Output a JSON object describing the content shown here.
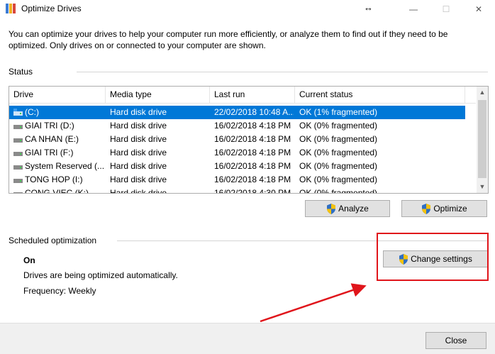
{
  "window": {
    "title": "Optimize Drives",
    "minimize_icon": "—",
    "maximize_icon": "☐",
    "close_icon": "✕",
    "resize_cursor": "↔"
  },
  "description": "You can optimize your drives to help your computer run more efficiently, or analyze them to find out if they need to be optimized. Only drives on or connected to your computer are shown.",
  "status": {
    "heading": "Status",
    "columns": [
      "Drive",
      "Media type",
      "Last run",
      "Current status"
    ],
    "drives": [
      {
        "drive": "(C:)",
        "media": "Hard disk drive",
        "last_run": "22/02/2018 10:48 A...",
        "status": "OK (1% fragmented)",
        "icon": "system-drive-icon"
      },
      {
        "drive": "GIAI TRI (D:)",
        "media": "Hard disk drive",
        "last_run": "16/02/2018 4:18 PM",
        "status": "OK (0% fragmented)",
        "icon": "hard-drive-icon"
      },
      {
        "drive": "CA NHAN (E:)",
        "media": "Hard disk drive",
        "last_run": "16/02/2018 4:18 PM",
        "status": "OK (0% fragmented)",
        "icon": "hard-drive-icon"
      },
      {
        "drive": "GIAI TRI (F:)",
        "media": "Hard disk drive",
        "last_run": "16/02/2018 4:18 PM",
        "status": "OK (0% fragmented)",
        "icon": "hard-drive-icon"
      },
      {
        "drive": "System Reserved (...",
        "media": "Hard disk drive",
        "last_run": "16/02/2018 4:18 PM",
        "status": "OK (0% fragmented)",
        "icon": "hard-drive-icon"
      },
      {
        "drive": "TONG HOP (I:)",
        "media": "Hard disk drive",
        "last_run": "16/02/2018 4:18 PM",
        "status": "OK (0% fragmented)",
        "icon": "hard-drive-icon"
      },
      {
        "drive": "CONG VIEC (K:)",
        "media": "Hard disk drive",
        "last_run": "16/02/2018 4:30 PM",
        "status": "OK (0% fragmented)",
        "icon": "hard-drive-icon"
      }
    ],
    "selected_index": 0,
    "analyze_label": "Analyze",
    "optimize_label": "Optimize"
  },
  "schedule": {
    "heading": "Scheduled optimization",
    "state": "On",
    "detail": "Drives are being optimized automatically.",
    "frequency": "Frequency: Weekly",
    "change_settings_label": "Change settings"
  },
  "footer": {
    "close_label": "Close"
  },
  "annotation": {
    "color": "#e0151b"
  }
}
